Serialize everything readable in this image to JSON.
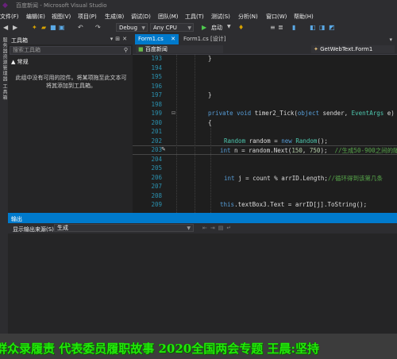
{
  "window": {
    "title": "百度新闻 - Microsoft Visual Studio"
  },
  "menu": [
    "文件(F)",
    "编辑(E)",
    "视图(V)",
    "项目(P)",
    "生成(B)",
    "调试(D)",
    "团队(M)",
    "工具(T)",
    "测试(S)",
    "分析(N)",
    "窗口(W)",
    "帮助(H)"
  ],
  "toolbar": {
    "config": "Debug",
    "platform": "Any CPU",
    "start_label": "启动"
  },
  "left_strip": {
    "label": "服务器资源管理器 工具箱"
  },
  "toolbox": {
    "title": "工具箱",
    "search_placeholder": "搜索工具箱",
    "group": "▲ 常规",
    "empty_message": "此组中没有可用的控件。将某项拖至此文本可将其添加到工具箱。"
  },
  "editor": {
    "tabs": [
      {
        "label": "Form1.cs",
        "close": "✕"
      },
      {
        "label": "Form1.cs [设计]"
      }
    ],
    "nav_left": "百度新闻",
    "nav_right": "GetWebText.Form1",
    "line_numbers": [
      "193",
      "194",
      "195",
      "196",
      "197",
      "198",
      "199",
      "200",
      "201",
      "202",
      "203",
      "204",
      "205",
      "206",
      "207",
      "208",
      "209"
    ]
  },
  "output": {
    "title": "输出",
    "source_label": "显示输出来源(S):",
    "source_value": "生成"
  },
  "banner": {
    "text": "群众录履责 代表委员履职故事 2020全国两会专题 王晨:坚持"
  },
  "colors": {
    "accent": "#007acc",
    "banner_text": "#22e80a"
  }
}
